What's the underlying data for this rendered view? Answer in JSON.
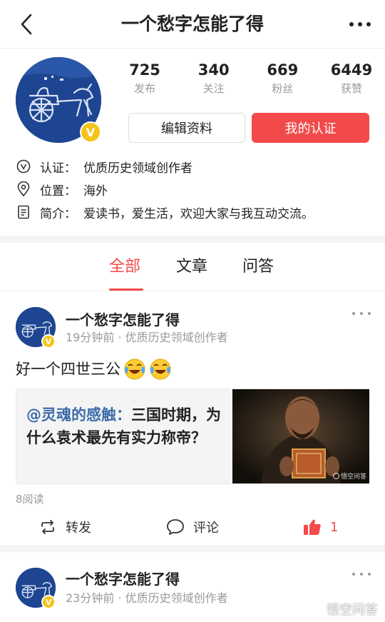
{
  "nav": {
    "title": "一个愁字怎能了得"
  },
  "profile": {
    "stats": [
      {
        "value": "725",
        "label": "发布"
      },
      {
        "value": "340",
        "label": "关注"
      },
      {
        "value": "669",
        "label": "粉丝"
      },
      {
        "value": "6449",
        "label": "获赞"
      }
    ],
    "edit_button": "编辑资料",
    "verify_button": "我的认证",
    "badge": "V",
    "info": [
      {
        "label": "认证：",
        "value": "优质历史领域创作者",
        "icon": "verify-icon"
      },
      {
        "label": "位置：",
        "value": "海外",
        "icon": "location-icon"
      },
      {
        "label": "简介：",
        "value": "爱读书，爱生活，欢迎大家与我互动交流。",
        "icon": "document-icon"
      }
    ]
  },
  "tabs": [
    {
      "label": "全部",
      "active": true
    },
    {
      "label": "文章",
      "active": false
    },
    {
      "label": "问答",
      "active": false
    }
  ],
  "posts": [
    {
      "author": "一个愁字怎能了得",
      "meta": "19分钟前 · 优质历史领域创作者",
      "text": "好一个四世三公",
      "share": {
        "user": "@灵魂的感触：",
        "title": "三国时期，为什么袁术最先有实力称帝？",
        "image_tag": "悟空问答"
      },
      "reads": "8阅读",
      "actions": {
        "repost": "转发",
        "comment": "评论",
        "likes": "1"
      }
    },
    {
      "author": "一个愁字怎能了得",
      "meta": "23分钟前 · 优质历史领域创作者"
    }
  ],
  "watermark": "悟空问答",
  "colors": {
    "accent": "#f24a4a",
    "link": "#3d6ca9",
    "badge": "#f5c41a",
    "muted": "#9a9a9a"
  }
}
